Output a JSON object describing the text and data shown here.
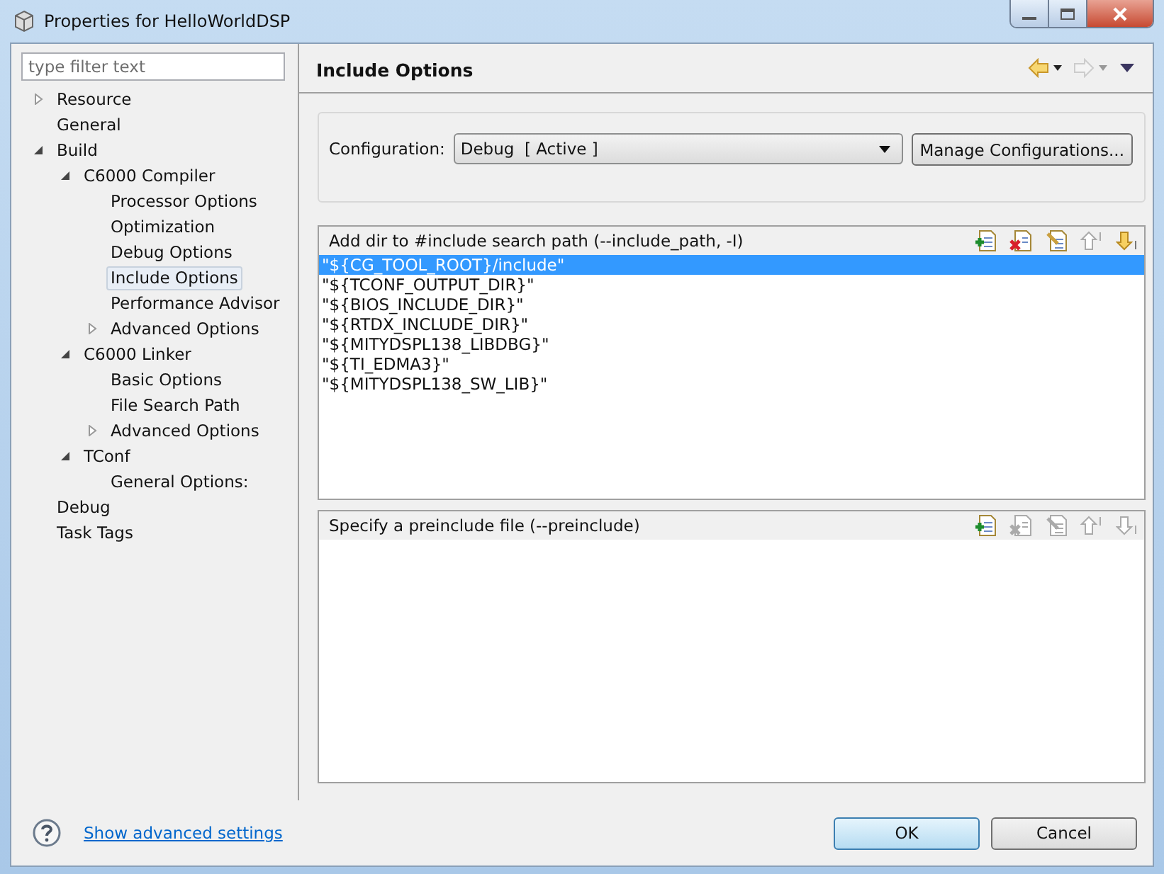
{
  "window": {
    "title": "Properties for HelloWorldDSP"
  },
  "filter": {
    "placeholder": "type filter text"
  },
  "tree": [
    {
      "label": "Resource",
      "expanded": false,
      "selected": false
    },
    {
      "label": "General",
      "selected": false
    },
    {
      "label": "Build",
      "expanded": true,
      "selected": false,
      "children": [
        {
          "label": "C6000 Compiler",
          "expanded": true,
          "selected": false,
          "children": [
            {
              "label": "Processor Options",
              "selected": false
            },
            {
              "label": "Optimization",
              "selected": false
            },
            {
              "label": "Debug Options",
              "selected": false
            },
            {
              "label": "Include Options",
              "selected": true
            },
            {
              "label": "Performance Advisor",
              "selected": false
            },
            {
              "label": "Advanced Options",
              "expanded": false,
              "selected": false
            }
          ]
        },
        {
          "label": "C6000 Linker",
          "expanded": true,
          "selected": false,
          "children": [
            {
              "label": "Basic Options",
              "selected": false
            },
            {
              "label": "File Search Path",
              "selected": false
            },
            {
              "label": "Advanced Options",
              "expanded": false,
              "selected": false
            }
          ]
        },
        {
          "label": "TConf",
          "expanded": true,
          "selected": false,
          "children": [
            {
              "label": "General Options:",
              "selected": false
            }
          ]
        }
      ]
    },
    {
      "label": "Debug",
      "selected": false
    },
    {
      "label": "Task Tags",
      "selected": false
    }
  ],
  "page": {
    "title": "Include Options",
    "nav": [
      {
        "kind": "back",
        "disabled": false
      },
      {
        "kind": "forward",
        "disabled": true
      },
      {
        "kind": "menu",
        "disabled": false
      }
    ]
  },
  "configuration": {
    "label": "Configuration:",
    "value": "Debug  [ Active ]",
    "button": "Manage Configurations..."
  },
  "lists": [
    {
      "title": "Add dir to #include search path (--include_path, -I)",
      "tools": [
        {
          "kind": "add",
          "disabled": false
        },
        {
          "kind": "delete",
          "disabled": false
        },
        {
          "kind": "edit",
          "disabled": false
        },
        {
          "kind": "up",
          "disabled": true
        },
        {
          "kind": "down",
          "disabled": false
        }
      ],
      "items": [
        {
          "text": "\"${CG_TOOL_ROOT}/include\"",
          "selected": true
        },
        {
          "text": "\"${TCONF_OUTPUT_DIR}\"",
          "selected": false
        },
        {
          "text": "\"${BIOS_INCLUDE_DIR}\"",
          "selected": false
        },
        {
          "text": "\"${RTDX_INCLUDE_DIR}\"",
          "selected": false
        },
        {
          "text": "\"${MITYDSPL138_LIBDBG}\"",
          "selected": false
        },
        {
          "text": "\"${TI_EDMA3}\"",
          "selected": false
        },
        {
          "text": "\"${MITYDSPL138_SW_LIB}\"",
          "selected": false
        }
      ]
    },
    {
      "title": "Specify a preinclude file (--preinclude)",
      "tools": [
        {
          "kind": "add",
          "disabled": false
        },
        {
          "kind": "delete",
          "disabled": true
        },
        {
          "kind": "edit",
          "disabled": true
        },
        {
          "kind": "up",
          "disabled": true
        },
        {
          "kind": "down",
          "disabled": true
        }
      ]
    }
  ],
  "footer": {
    "link": "Show advanced settings",
    "buttons": [
      {
        "label": "OK",
        "default": true
      },
      {
        "label": "Cancel",
        "default": false
      }
    ]
  }
}
